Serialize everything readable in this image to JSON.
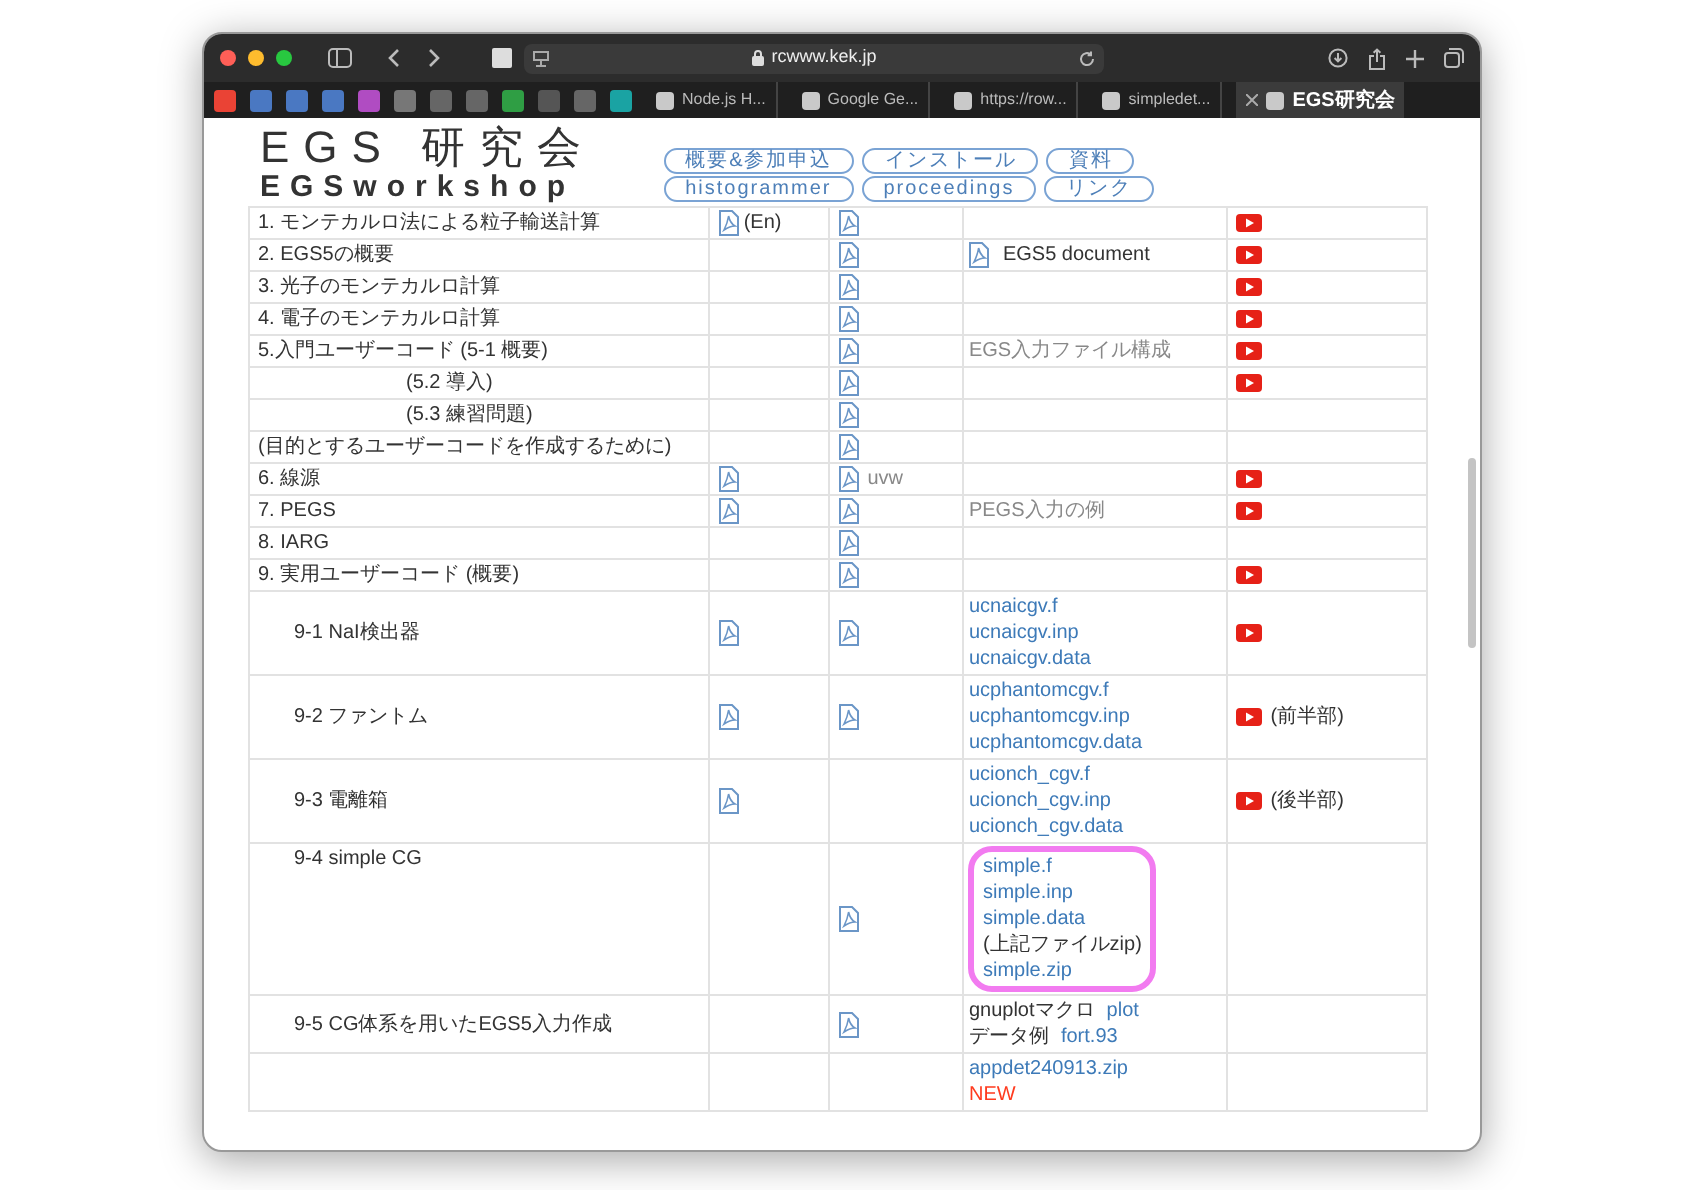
{
  "browser": {
    "url": "rcwww.kek.jp",
    "tabs": [
      {
        "title": "Node.js H...",
        "selected": false
      },
      {
        "title": "Google Ge...",
        "selected": false
      },
      {
        "title": "https://row...",
        "selected": false
      },
      {
        "title": "simpledet...",
        "selected": false
      },
      {
        "title": "EGS研究会",
        "selected": true
      }
    ]
  },
  "header": {
    "title": "EGS 研究会",
    "subtitle": "EGSworkshop",
    "nav": [
      [
        "概要&参加申込",
        "インストール",
        "資料"
      ],
      [
        "histogrammer",
        "proceedings",
        "リンク"
      ]
    ]
  },
  "table": {
    "rows": [
      {
        "title": "1. モンテカルロ法による粒子輸送計算",
        "kind": "plain",
        "col2": [
          {
            "kind": "pdf"
          },
          {
            "kind": "text",
            "text": "(En)"
          }
        ],
        "col3": [
          {
            "kind": "pdf"
          }
        ],
        "col4": [],
        "col5": {
          "video": true
        }
      },
      {
        "title": "2. EGS5の概要",
        "kind": "plain",
        "col2": [],
        "col3": [
          {
            "kind": "pdf"
          }
        ],
        "col4": [
          [
            {
              "kind": "pdf"
            },
            {
              "kind": "text",
              "text": "EGS5 document"
            }
          ]
        ],
        "col5": {
          "video": true
        }
      },
      {
        "title": "3. 光子のモンテカルロ計算",
        "kind": "plain",
        "col2": [],
        "col3": [
          {
            "kind": "pdf"
          }
        ],
        "col4": [],
        "col5": {
          "video": true
        }
      },
      {
        "title": "4. 電子のモンテカルロ計算",
        "kind": "plain",
        "col2": [],
        "col3": [
          {
            "kind": "pdf"
          }
        ],
        "col4": [],
        "col5": {
          "video": true
        }
      },
      {
        "title": "5.入門ユーザーコード (5-1 概要)",
        "kind": "plain",
        "col2": [],
        "col3": [
          {
            "kind": "pdf"
          }
        ],
        "col4": [
          [
            {
              "kind": "note",
              "text": "EGS入力ファイル構成"
            }
          ]
        ],
        "col5": {
          "video": true
        }
      },
      {
        "title": "(5.2 導入)",
        "kind": "centered",
        "col2": [],
        "col3": [
          {
            "kind": "pdf"
          }
        ],
        "col4": [],
        "col5": {
          "video": true
        }
      },
      {
        "title": "(5.3 練習問題)",
        "kind": "centered",
        "col2": [],
        "col3": [
          {
            "kind": "pdf"
          }
        ],
        "col4": [],
        "col5": {
          "video": false
        }
      },
      {
        "title": "(目的とするユーザーコードを作成するために)",
        "kind": "plain",
        "col2": [],
        "col3": [
          {
            "kind": "pdf"
          }
        ],
        "col4": [],
        "col5": {
          "video": false
        }
      },
      {
        "title": "6. 線源",
        "kind": "plain",
        "col2": [
          {
            "kind": "pdf"
          }
        ],
        "col3": [
          {
            "kind": "pdf"
          },
          {
            "kind": "note",
            "text": "uvw"
          }
        ],
        "col4": [],
        "col5": {
          "video": true
        }
      },
      {
        "title": "7. PEGS",
        "kind": "plain",
        "col2": [
          {
            "kind": "pdf"
          }
        ],
        "col3": [
          {
            "kind": "pdf"
          }
        ],
        "col4": [
          [
            {
              "kind": "note",
              "text": "PEGS入力の例"
            }
          ]
        ],
        "col5": {
          "video": true
        }
      },
      {
        "title": "8. IARG",
        "kind": "plain",
        "col2": [],
        "col3": [
          {
            "kind": "pdf"
          }
        ],
        "col4": [],
        "col5": {
          "video": false
        }
      },
      {
        "title": "9. 実用ユーザーコード (概要)",
        "kind": "plain",
        "col2": [],
        "col3": [
          {
            "kind": "pdf"
          }
        ],
        "col4": [],
        "col5": {
          "video": true
        }
      },
      {
        "title": "9-1 NaI検出器",
        "kind": "indented",
        "col2": [
          {
            "kind": "pdf"
          }
        ],
        "col3": [
          {
            "kind": "pdf"
          }
        ],
        "col4": [
          [
            {
              "kind": "link",
              "text": "ucnaicgv.f"
            }
          ],
          [
            {
              "kind": "link",
              "text": "ucnaicgv.inp"
            }
          ],
          [
            {
              "kind": "link",
              "text": "ucnaicgv.data"
            }
          ]
        ],
        "col5": {
          "video": true
        }
      },
      {
        "title": "9-2 ファントム",
        "kind": "indented",
        "col2": [
          {
            "kind": "pdf"
          }
        ],
        "col3": [
          {
            "kind": "pdf"
          }
        ],
        "col4": [
          [
            {
              "kind": "link",
              "text": "ucphantomcgv.f"
            }
          ],
          [
            {
              "kind": "link",
              "text": "ucphantomcgv.inp"
            }
          ],
          [
            {
              "kind": "link",
              "text": "ucphantomcgv.data"
            }
          ]
        ],
        "col5": {
          "video": true,
          "note": "(前半部)"
        }
      },
      {
        "title": "9-3 電離箱",
        "kind": "indented",
        "col2": [
          {
            "kind": "pdf"
          }
        ],
        "col3": [],
        "col4": [
          [
            {
              "kind": "link",
              "text": "ucionch_cgv.f"
            }
          ],
          [
            {
              "kind": "link",
              "text": "ucionch_cgv.inp"
            }
          ],
          [
            {
              "kind": "link",
              "text": "ucionch_cgv.data"
            }
          ]
        ],
        "col5": {
          "video": true,
          "note": "(後半部)"
        }
      },
      {
        "title": "9-4 simple CG",
        "kind": "indented",
        "highlighted": true,
        "col2": [],
        "col3": [
          {
            "kind": "pdf"
          }
        ],
        "col4": [
          [
            {
              "kind": "link",
              "text": "simple.f"
            }
          ],
          [
            {
              "kind": "link",
              "text": "simple.inp"
            }
          ],
          [
            {
              "kind": "link",
              "text": "simple.data"
            }
          ],
          [
            {
              "kind": "text",
              "text": "(上記ファイルzip)"
            }
          ],
          [
            {
              "kind": "link",
              "text": "simple.zip"
            }
          ]
        ],
        "col5": {
          "video": false
        }
      },
      {
        "title": "9-5 CG体系を用いたEGS5入力作成",
        "kind": "indented",
        "col2": [],
        "col3": [
          {
            "kind": "pdf"
          }
        ],
        "col4": [
          [
            {
              "kind": "text",
              "text": "gnuplotマクロ"
            },
            {
              "kind": "link",
              "text": "plot"
            }
          ],
          [
            {
              "kind": "text",
              "text": "データ例"
            },
            {
              "kind": "link",
              "text": "fort.93"
            }
          ]
        ],
        "col5": {
          "video": false
        }
      },
      {
        "kind": "plain",
        "col2": [],
        "col3": [],
        "col4": [
          [
            {
              "kind": "link",
              "text": "appdet240913.zip"
            }
          ],
          [
            {
              "kind": "new",
              "text": "NEW"
            }
          ]
        ],
        "col5": {
          "video": false
        }
      }
    ]
  }
}
